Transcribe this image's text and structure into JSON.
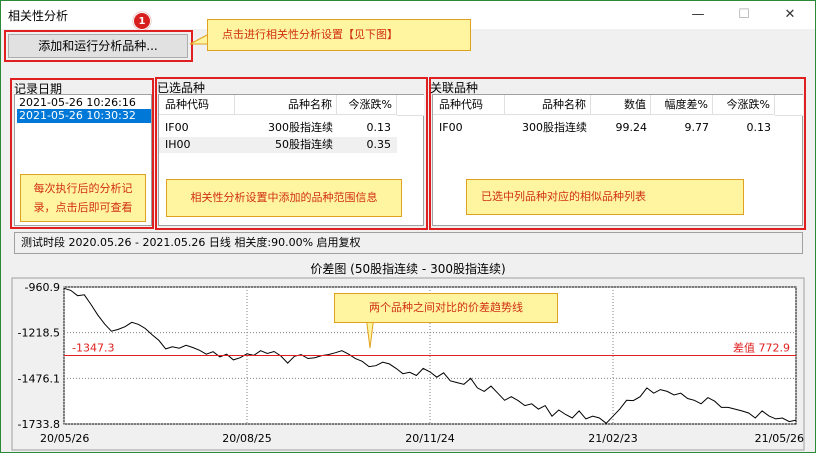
{
  "window": {
    "title": "相关性分析",
    "minimize": "—",
    "maximize": "☐",
    "close": "✕"
  },
  "toolbar": {
    "add_run_label": "添加和运行分析品种..."
  },
  "annotations": {
    "badge": "1",
    "settings_hint": "点击进行相关性分析设置【见下图】",
    "records_hint": "每次执行后的分析记录，点击后即可查看",
    "selected_hint": "相关性分析设置中添加的品种范围信息",
    "related_hint": "已选中列品种对应的相似品种列表",
    "chart_hint": "两个品种之间对比的价差趋势线"
  },
  "records": {
    "label": "记录日期",
    "items": [
      "2021-05-26 10:26:16",
      "2021-05-26 10:30:32"
    ],
    "selected_index": 1
  },
  "selected": {
    "label": "已选品种",
    "columns": [
      "品种代码",
      "品种名称",
      "今涨跌%"
    ],
    "rows": [
      [
        "IF00",
        "300股指连续",
        "0.13"
      ],
      [
        "IH00",
        "50股指连续",
        "0.35"
      ]
    ]
  },
  "related": {
    "label": "关联品种",
    "columns": [
      "品种代码",
      "品种名称",
      "数值",
      "幅度差%",
      "今涨跌%"
    ],
    "rows": [
      [
        "IF00",
        "300股指连续",
        "99.24",
        "9.77",
        "0.13"
      ]
    ]
  },
  "info": {
    "text": "测试时段 2020.05.26 - 2021.05.26 日线 相关度:90.00% 启用复权"
  },
  "chart_data": {
    "type": "line",
    "title": "价差图 (50股指连续 - 300股指连续)",
    "ylim": [
      -1733.8,
      -960.9
    ],
    "y_ticks": [
      "-960.9",
      "-1218.5",
      "-1476.1",
      "-1733.8"
    ],
    "x_ticks": [
      "20/05/26",
      "20/08/25",
      "20/11/24",
      "21/02/23",
      "21/05/26"
    ],
    "reference_line": {
      "value": -1347.3,
      "label": "-1347.3",
      "right_label": "差值 772.9",
      "color": "#e02020"
    },
    "series": [
      {
        "color": "#000000",
        "values": [
          -968,
          -980,
          -1010,
          -1005,
          -1060,
          -1120,
          -1170,
          -1210,
          -1200,
          -1185,
          -1160,
          -1172,
          -1195,
          -1230,
          -1262,
          -1310,
          -1298,
          -1306,
          -1290,
          -1302,
          -1318,
          -1340,
          -1326,
          -1355,
          -1340,
          -1372,
          -1360,
          -1338,
          -1347,
          -1320,
          -1336,
          -1325,
          -1350,
          -1390,
          -1352,
          -1343,
          -1364,
          -1360,
          -1348,
          -1342,
          -1332,
          -1320,
          -1340,
          -1365,
          -1380,
          -1410,
          -1405,
          -1385,
          -1395,
          -1420,
          -1450,
          -1442,
          -1460,
          -1420,
          -1440,
          -1470,
          -1445,
          -1490,
          -1500,
          -1510,
          -1476,
          -1530,
          -1550,
          -1520,
          -1560,
          -1600,
          -1580,
          -1602,
          -1630,
          -1620,
          -1650,
          -1630,
          -1690,
          -1655,
          -1680,
          -1700,
          -1660,
          -1705,
          -1690,
          -1700,
          -1730,
          -1690,
          -1650,
          -1600,
          -1602,
          -1580,
          -1530,
          -1560,
          -1540,
          -1550,
          -1570,
          -1560,
          -1590,
          -1600,
          -1620,
          -1585,
          -1605,
          -1640,
          -1640,
          -1650,
          -1660,
          -1672,
          -1700,
          -1660,
          -1688,
          -1705,
          -1700,
          -1720,
          -1712
        ]
      }
    ]
  }
}
